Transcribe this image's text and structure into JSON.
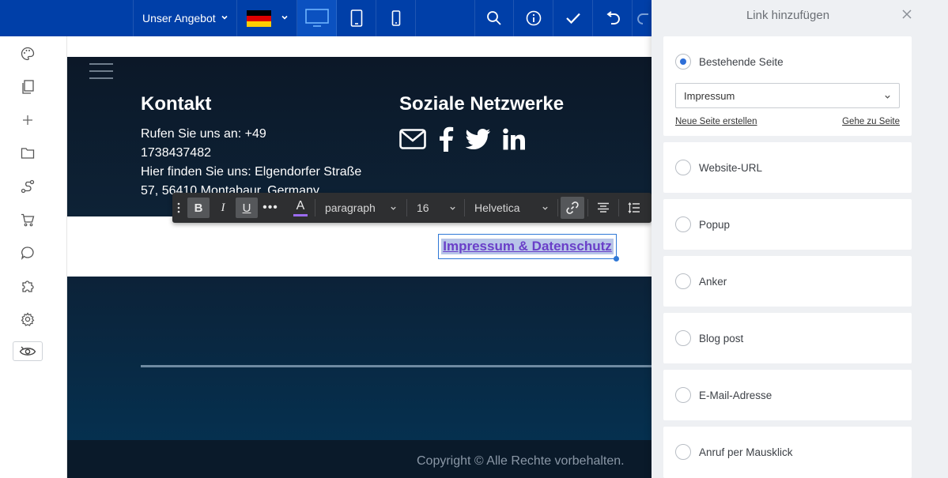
{
  "topbar": {
    "page_select": "Unser Angebot",
    "language_flag_colors": [
      "#000000",
      "#dd0000",
      "#ffce00"
    ],
    "icons": [
      "desktop-icon",
      "tablet-icon",
      "mobile-icon",
      "search-icon",
      "info-icon",
      "check-icon",
      "undo-icon",
      "redo-icon"
    ],
    "accent": "#003fa8"
  },
  "sidebar": {
    "icons": [
      "palette-icon",
      "pages-icon",
      "plus-icon",
      "folder-icon",
      "route-icon",
      "cart-icon",
      "chat-icon",
      "puzzle-icon",
      "gear-icon",
      "preview-eye-icon"
    ]
  },
  "canvas": {
    "contact_title": "Kontakt",
    "contact_line1": "Rufen Sie uns an: +49",
    "contact_line2": "1738437482",
    "contact_line3": "Hier finden Sie uns: Elgendorfer Straße",
    "contact_line4": "57, 56410 Montabaur, Germany",
    "social_title": "Soziale Netzwerke",
    "social_icons": [
      "mail-icon",
      "facebook-icon",
      "twitter-icon",
      "linkedin-icon"
    ],
    "selected_link_text": "Impressum & Datenschutz",
    "copyright": "Copyright © Alle Rechte vorbehalten."
  },
  "text_toolbar": {
    "bold": "B",
    "italic": "I",
    "underline": "U",
    "more": "•••",
    "color_letter": "A",
    "format": "paragraph",
    "size": "16",
    "font": "Helvetica"
  },
  "link_panel": {
    "title": "Link hinzufügen",
    "options": [
      {
        "label": "Bestehende Seite",
        "selected": true
      },
      {
        "label": "Website-URL",
        "selected": false
      },
      {
        "label": "Popup",
        "selected": false
      },
      {
        "label": "Anker",
        "selected": false
      },
      {
        "label": "Blog post",
        "selected": false
      },
      {
        "label": "E-Mail-Adresse",
        "selected": false
      },
      {
        "label": "Anruf per Mausklick",
        "selected": false
      }
    ],
    "page_select_value": "Impressum",
    "new_page_link": "Neue Seite erstellen",
    "goto_page_link": "Gehe zu Seite"
  }
}
